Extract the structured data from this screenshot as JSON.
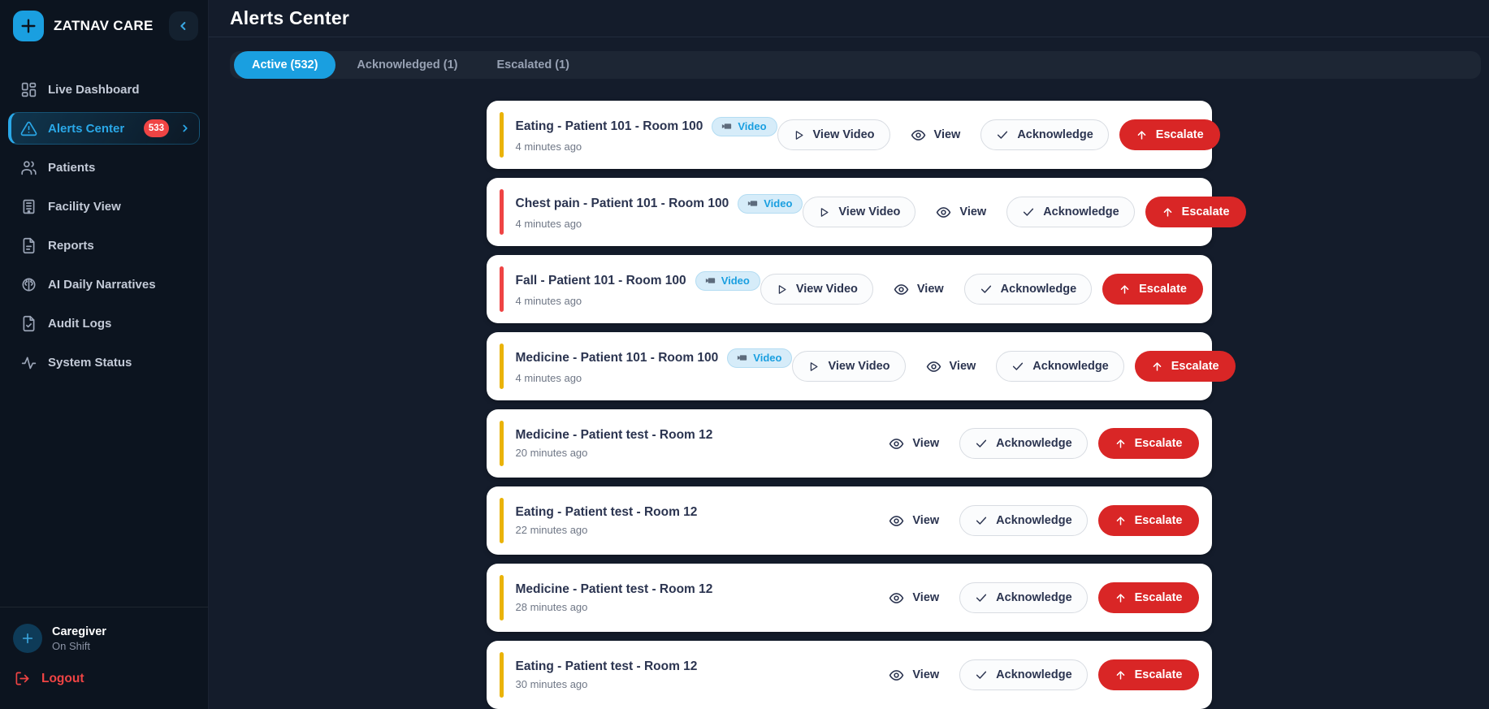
{
  "brand": {
    "name": "ZATNAV CARE"
  },
  "sidebar": {
    "items": [
      {
        "label": "Live Dashboard",
        "icon": "dashboard-icon"
      },
      {
        "label": "Alerts Center",
        "icon": "alert-triangle-icon",
        "badge": "533",
        "active": true
      },
      {
        "label": "Patients",
        "icon": "users-icon"
      },
      {
        "label": "Facility View",
        "icon": "building-icon"
      },
      {
        "label": "Reports",
        "icon": "file-icon"
      },
      {
        "label": "AI Daily Narratives",
        "icon": "brain-icon"
      },
      {
        "label": "Audit Logs",
        "icon": "file-check-icon"
      },
      {
        "label": "System Status",
        "icon": "activity-icon"
      }
    ],
    "profile": {
      "name": "Caregiver",
      "status": "On Shift"
    },
    "logout_label": "Logout"
  },
  "header": {
    "title": "Alerts Center"
  },
  "tabs": [
    {
      "label": "Active (532)",
      "active": true
    },
    {
      "label": "Acknowledged (1)",
      "active": false
    },
    {
      "label": "Escalated (1)",
      "active": false
    }
  ],
  "actions": {
    "view_video": "View Video",
    "view": "View",
    "acknowledge": "Acknowledge",
    "escalate": "Escalate"
  },
  "badges": {
    "video_label": "Video"
  },
  "alerts": [
    {
      "title": "Eating - Patient 101 - Room 100",
      "time": "4 minutes ago",
      "severity": "warning",
      "video": true
    },
    {
      "title": "Chest pain - Patient 101 - Room 100",
      "time": "4 minutes ago",
      "severity": "critical",
      "video": true
    },
    {
      "title": "Fall - Patient 101 - Room 100",
      "time": "4 minutes ago",
      "severity": "critical",
      "video": true
    },
    {
      "title": "Medicine - Patient 101 - Room 100",
      "time": "4 minutes ago",
      "severity": "warning",
      "video": true
    },
    {
      "title": "Medicine - Patient test - Room 12",
      "time": "20 minutes ago",
      "severity": "warning",
      "video": false
    },
    {
      "title": "Eating - Patient test - Room 12",
      "time": "22 minutes ago",
      "severity": "warning",
      "video": false
    },
    {
      "title": "Medicine - Patient test - Room 12",
      "time": "28 minutes ago",
      "severity": "warning",
      "video": false
    },
    {
      "title": "Eating - Patient test - Room 12",
      "time": "30 minutes ago",
      "severity": "warning",
      "video": false
    }
  ],
  "colors": {
    "sidebar_bg": "#0c141f",
    "main_bg": "#141c2b",
    "accent_blue": "#1a9fe0",
    "alert_badge_red": "#ef4444",
    "escalate_red": "#d92626",
    "warning_bar": "#eab308",
    "critical_bar": "#ef4444",
    "card_bg": "#ffffff"
  }
}
